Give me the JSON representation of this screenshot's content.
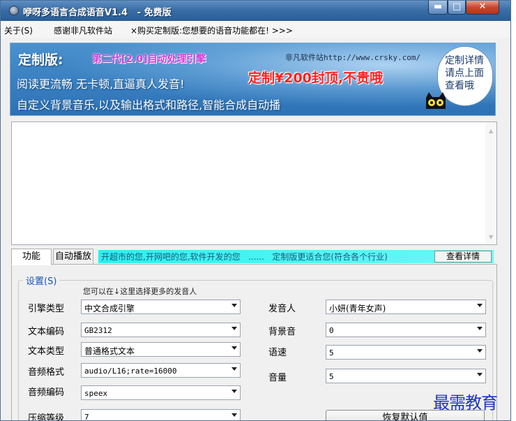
{
  "window": {
    "title": "咿呀多语言合成语音V1.4   - 免费版",
    "buttons": {
      "minimize": "▬",
      "maximize": "□",
      "close": "✕"
    }
  },
  "menu": {
    "items": [
      "关于(S)",
      "感谢非凡软件站",
      "×购买定制版:您想要的语音功能都在! >>>"
    ]
  },
  "banner": {
    "custom_label": "定制版:",
    "engine": "第二代[2.0]自动处理引擎",
    "site": "非凡软件站http://www.crsky.com/",
    "read": "阅读更流畅 无卡顿,直逼真人发音!",
    "price": "定制¥200封顶,不贵哦",
    "custom2": "自定义背景音乐,以及输出格式和路径,智能合成自动播",
    "bubble": "定制详情请点上面查看哦"
  },
  "editor": {
    "value": ""
  },
  "tabs": {
    "function": "功能",
    "autoplay": "自动播放",
    "marquee": "开超市的您,开网吧的您,软件开发的您   ......   定制版更适合您(符合各个行业)",
    "view_details": "查看详情"
  },
  "settings": {
    "group_title": "设置(S)",
    "hint": "您可以在↓这里选择更多的发音人",
    "engine_type": {
      "label": "引擎类型",
      "value": "中文合成引擎"
    },
    "text_encoding": {
      "label": "文本编码",
      "value": "GB2312"
    },
    "text_type": {
      "label": "文本类型",
      "value": "普通格式文本"
    },
    "audio_format": {
      "label": "音频格式",
      "value": "audio/L16;rate=16000"
    },
    "audio_codec": {
      "label": "音频编码",
      "value": "speex"
    },
    "compression": {
      "label": "压缩等级",
      "value": "7"
    },
    "speaker": {
      "label": "发音人",
      "value": "小妍(青年女声)"
    },
    "bg_sound": {
      "label": "背景音",
      "value": "0"
    },
    "speed": {
      "label": "语速",
      "value": "5"
    },
    "volume": {
      "label": "音量",
      "value": "5"
    },
    "restore": "恢复默认值"
  },
  "watermark": "最需教育",
  "colors": {
    "titlebar": "#3a6ea5",
    "banner": "#2c71b5",
    "marquee": "#2cf0f0",
    "price": "#ff2020",
    "watermark": "#1d34c8"
  }
}
